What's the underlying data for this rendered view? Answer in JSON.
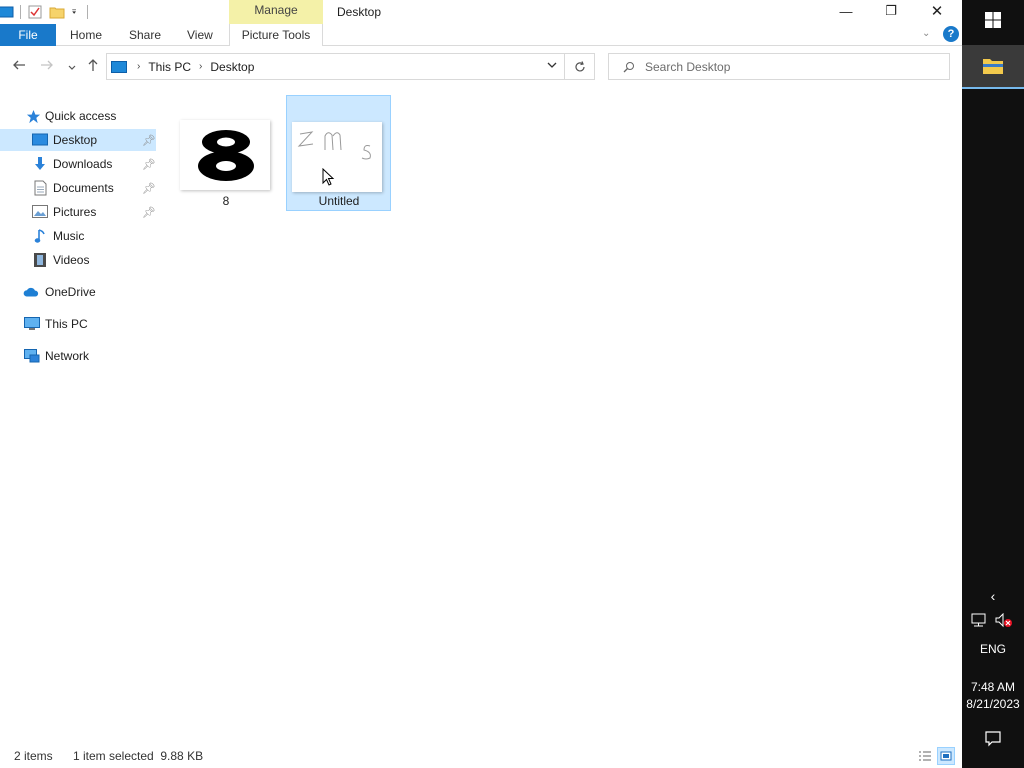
{
  "window": {
    "title": "Desktop",
    "contextual_tab_group": "Manage",
    "controls": {
      "minimize": "—",
      "maximize": "❐",
      "close": "✕"
    }
  },
  "ribbon": {
    "tabs": [
      "File",
      "Home",
      "Share",
      "View",
      "Picture Tools"
    ],
    "help": "?"
  },
  "navigation": {
    "breadcrumb": [
      "This PC",
      "Desktop"
    ],
    "search_placeholder": "Search Desktop"
  },
  "sidebar": {
    "items": [
      {
        "label": "Quick access",
        "icon": "star-icon"
      },
      {
        "label": "Desktop",
        "icon": "desktop-folder-icon",
        "pinned": true,
        "selected": true
      },
      {
        "label": "Downloads",
        "icon": "download-arrow-icon",
        "pinned": true
      },
      {
        "label": "Documents",
        "icon": "document-icon",
        "pinned": true
      },
      {
        "label": "Pictures",
        "icon": "pictures-icon",
        "pinned": true
      },
      {
        "label": "Music",
        "icon": "music-note-icon"
      },
      {
        "label": "Videos",
        "icon": "film-icon"
      },
      {
        "label": "OneDrive",
        "icon": "cloud-icon"
      },
      {
        "label": "This PC",
        "icon": "computer-icon"
      },
      {
        "label": "Network",
        "icon": "network-icon"
      }
    ]
  },
  "files": [
    {
      "name": "8",
      "thumbnail": "digit-8-drawing",
      "selected": false
    },
    {
      "name": "Untitled",
      "thumbnail": "zms-handwriting",
      "selected": true
    }
  ],
  "status": {
    "item_count": "2 items",
    "selection": "1 item selected  9.88 KB"
  },
  "taskbar": {
    "language": "ENG",
    "time": "7:48 AM",
    "date": "8/21/2023",
    "expand": "‹"
  },
  "colors": {
    "accent": "#1979ca",
    "selection": "#cce8ff",
    "manage_tab": "#f4f1a8",
    "taskbar": "#101010"
  }
}
